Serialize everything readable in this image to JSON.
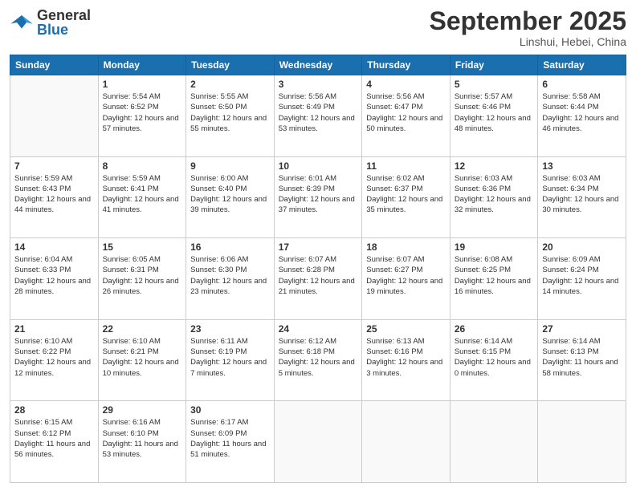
{
  "header": {
    "logo_general": "General",
    "logo_blue": "Blue",
    "month_title": "September 2025",
    "subtitle": "Linshui, Hebei, China"
  },
  "weekdays": [
    "Sunday",
    "Monday",
    "Tuesday",
    "Wednesday",
    "Thursday",
    "Friday",
    "Saturday"
  ],
  "weeks": [
    [
      {
        "day": "",
        "sunrise": "",
        "sunset": "",
        "daylight": ""
      },
      {
        "day": "1",
        "sunrise": "Sunrise: 5:54 AM",
        "sunset": "Sunset: 6:52 PM",
        "daylight": "Daylight: 12 hours and 57 minutes."
      },
      {
        "day": "2",
        "sunrise": "Sunrise: 5:55 AM",
        "sunset": "Sunset: 6:50 PM",
        "daylight": "Daylight: 12 hours and 55 minutes."
      },
      {
        "day": "3",
        "sunrise": "Sunrise: 5:56 AM",
        "sunset": "Sunset: 6:49 PM",
        "daylight": "Daylight: 12 hours and 53 minutes."
      },
      {
        "day": "4",
        "sunrise": "Sunrise: 5:56 AM",
        "sunset": "Sunset: 6:47 PM",
        "daylight": "Daylight: 12 hours and 50 minutes."
      },
      {
        "day": "5",
        "sunrise": "Sunrise: 5:57 AM",
        "sunset": "Sunset: 6:46 PM",
        "daylight": "Daylight: 12 hours and 48 minutes."
      },
      {
        "day": "6",
        "sunrise": "Sunrise: 5:58 AM",
        "sunset": "Sunset: 6:44 PM",
        "daylight": "Daylight: 12 hours and 46 minutes."
      }
    ],
    [
      {
        "day": "7",
        "sunrise": "Sunrise: 5:59 AM",
        "sunset": "Sunset: 6:43 PM",
        "daylight": "Daylight: 12 hours and 44 minutes."
      },
      {
        "day": "8",
        "sunrise": "Sunrise: 5:59 AM",
        "sunset": "Sunset: 6:41 PM",
        "daylight": "Daylight: 12 hours and 41 minutes."
      },
      {
        "day": "9",
        "sunrise": "Sunrise: 6:00 AM",
        "sunset": "Sunset: 6:40 PM",
        "daylight": "Daylight: 12 hours and 39 minutes."
      },
      {
        "day": "10",
        "sunrise": "Sunrise: 6:01 AM",
        "sunset": "Sunset: 6:39 PM",
        "daylight": "Daylight: 12 hours and 37 minutes."
      },
      {
        "day": "11",
        "sunrise": "Sunrise: 6:02 AM",
        "sunset": "Sunset: 6:37 PM",
        "daylight": "Daylight: 12 hours and 35 minutes."
      },
      {
        "day": "12",
        "sunrise": "Sunrise: 6:03 AM",
        "sunset": "Sunset: 6:36 PM",
        "daylight": "Daylight: 12 hours and 32 minutes."
      },
      {
        "day": "13",
        "sunrise": "Sunrise: 6:03 AM",
        "sunset": "Sunset: 6:34 PM",
        "daylight": "Daylight: 12 hours and 30 minutes."
      }
    ],
    [
      {
        "day": "14",
        "sunrise": "Sunrise: 6:04 AM",
        "sunset": "Sunset: 6:33 PM",
        "daylight": "Daylight: 12 hours and 28 minutes."
      },
      {
        "day": "15",
        "sunrise": "Sunrise: 6:05 AM",
        "sunset": "Sunset: 6:31 PM",
        "daylight": "Daylight: 12 hours and 26 minutes."
      },
      {
        "day": "16",
        "sunrise": "Sunrise: 6:06 AM",
        "sunset": "Sunset: 6:30 PM",
        "daylight": "Daylight: 12 hours and 23 minutes."
      },
      {
        "day": "17",
        "sunrise": "Sunrise: 6:07 AM",
        "sunset": "Sunset: 6:28 PM",
        "daylight": "Daylight: 12 hours and 21 minutes."
      },
      {
        "day": "18",
        "sunrise": "Sunrise: 6:07 AM",
        "sunset": "Sunset: 6:27 PM",
        "daylight": "Daylight: 12 hours and 19 minutes."
      },
      {
        "day": "19",
        "sunrise": "Sunrise: 6:08 AM",
        "sunset": "Sunset: 6:25 PM",
        "daylight": "Daylight: 12 hours and 16 minutes."
      },
      {
        "day": "20",
        "sunrise": "Sunrise: 6:09 AM",
        "sunset": "Sunset: 6:24 PM",
        "daylight": "Daylight: 12 hours and 14 minutes."
      }
    ],
    [
      {
        "day": "21",
        "sunrise": "Sunrise: 6:10 AM",
        "sunset": "Sunset: 6:22 PM",
        "daylight": "Daylight: 12 hours and 12 minutes."
      },
      {
        "day": "22",
        "sunrise": "Sunrise: 6:10 AM",
        "sunset": "Sunset: 6:21 PM",
        "daylight": "Daylight: 12 hours and 10 minutes."
      },
      {
        "day": "23",
        "sunrise": "Sunrise: 6:11 AM",
        "sunset": "Sunset: 6:19 PM",
        "daylight": "Daylight: 12 hours and 7 minutes."
      },
      {
        "day": "24",
        "sunrise": "Sunrise: 6:12 AM",
        "sunset": "Sunset: 6:18 PM",
        "daylight": "Daylight: 12 hours and 5 minutes."
      },
      {
        "day": "25",
        "sunrise": "Sunrise: 6:13 AM",
        "sunset": "Sunset: 6:16 PM",
        "daylight": "Daylight: 12 hours and 3 minutes."
      },
      {
        "day": "26",
        "sunrise": "Sunrise: 6:14 AM",
        "sunset": "Sunset: 6:15 PM",
        "daylight": "Daylight: 12 hours and 0 minutes."
      },
      {
        "day": "27",
        "sunrise": "Sunrise: 6:14 AM",
        "sunset": "Sunset: 6:13 PM",
        "daylight": "Daylight: 11 hours and 58 minutes."
      }
    ],
    [
      {
        "day": "28",
        "sunrise": "Sunrise: 6:15 AM",
        "sunset": "Sunset: 6:12 PM",
        "daylight": "Daylight: 11 hours and 56 minutes."
      },
      {
        "day": "29",
        "sunrise": "Sunrise: 6:16 AM",
        "sunset": "Sunset: 6:10 PM",
        "daylight": "Daylight: 11 hours and 53 minutes."
      },
      {
        "day": "30",
        "sunrise": "Sunrise: 6:17 AM",
        "sunset": "Sunset: 6:09 PM",
        "daylight": "Daylight: 11 hours and 51 minutes."
      },
      {
        "day": "",
        "sunrise": "",
        "sunset": "",
        "daylight": ""
      },
      {
        "day": "",
        "sunrise": "",
        "sunset": "",
        "daylight": ""
      },
      {
        "day": "",
        "sunrise": "",
        "sunset": "",
        "daylight": ""
      },
      {
        "day": "",
        "sunrise": "",
        "sunset": "",
        "daylight": ""
      }
    ]
  ]
}
